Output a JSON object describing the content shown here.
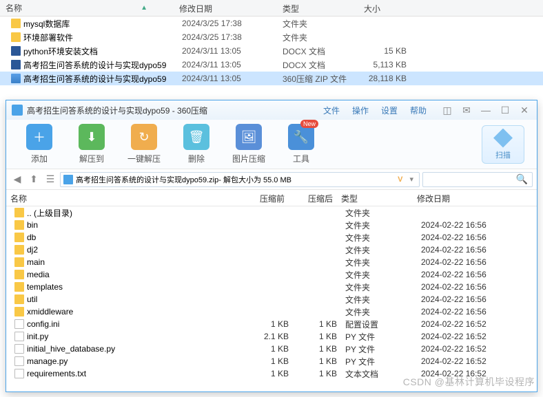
{
  "bg": {
    "headers": {
      "name": "名称",
      "date": "修改日期",
      "type": "类型",
      "size": "大小"
    },
    "rows": [
      {
        "icon": "folder",
        "name": "mysql数据库",
        "date": "2024/3/25 17:38",
        "type": "文件夹",
        "size": ""
      },
      {
        "icon": "folder",
        "name": "环境部署软件",
        "date": "2024/3/25 17:38",
        "type": "文件夹",
        "size": ""
      },
      {
        "icon": "docx",
        "name": "python环境安装文档",
        "date": "2024/3/11 13:05",
        "type": "DOCX 文档",
        "size": "15 KB"
      },
      {
        "icon": "docx",
        "name": "高考招生问答系统的设计与实现dypo59",
        "date": "2024/3/11 13:05",
        "type": "DOCX 文档",
        "size": "5,113 KB"
      },
      {
        "icon": "zip",
        "name": "高考招生问答系统的设计与实现dypo59",
        "date": "2024/3/11 13:05",
        "type": "360压缩 ZIP 文件",
        "size": "28,118 KB",
        "selected": true
      }
    ]
  },
  "zipwin": {
    "title": "高考招生问答系统的设计与实现dypo59 - 360压缩",
    "menu": {
      "file": "文件",
      "op": "操作",
      "set": "设置",
      "help": "帮助"
    },
    "toolbar": {
      "add": "添加",
      "extract": "解压到",
      "onekey": "一键解压",
      "delete": "删除",
      "imgzip": "图片压缩",
      "tools": "工具",
      "new": "New",
      "scan": "扫描"
    },
    "addr": {
      "file": "高考招生问答系统的设计与实现dypo59.zip",
      "info": " - 解包大小为 55.0 MB",
      "v": "V"
    },
    "list_headers": {
      "name": "名称",
      "before": "压缩前",
      "after": "压缩后",
      "type": "类型",
      "date": "修改日期"
    },
    "rows": [
      {
        "icon": "folder",
        "name": ".. (上级目录)",
        "before": "",
        "after": "",
        "type": "文件夹",
        "date": ""
      },
      {
        "icon": "folder",
        "name": "bin",
        "before": "",
        "after": "",
        "type": "文件夹",
        "date": "2024-02-22 16:56"
      },
      {
        "icon": "folder",
        "name": "db",
        "before": "",
        "after": "",
        "type": "文件夹",
        "date": "2024-02-22 16:56"
      },
      {
        "icon": "folder",
        "name": "dj2",
        "before": "",
        "after": "",
        "type": "文件夹",
        "date": "2024-02-22 16:56"
      },
      {
        "icon": "folder",
        "name": "main",
        "before": "",
        "after": "",
        "type": "文件夹",
        "date": "2024-02-22 16:56"
      },
      {
        "icon": "folder",
        "name": "media",
        "before": "",
        "after": "",
        "type": "文件夹",
        "date": "2024-02-22 16:56"
      },
      {
        "icon": "folder",
        "name": "templates",
        "before": "",
        "after": "",
        "type": "文件夹",
        "date": "2024-02-22 16:56"
      },
      {
        "icon": "folder",
        "name": "util",
        "before": "",
        "after": "",
        "type": "文件夹",
        "date": "2024-02-22 16:56"
      },
      {
        "icon": "folder",
        "name": "xmiddleware",
        "before": "",
        "after": "",
        "type": "文件夹",
        "date": "2024-02-22 16:56"
      },
      {
        "icon": "file",
        "name": "config.ini",
        "before": "1 KB",
        "after": "1 KB",
        "type": "配置设置",
        "date": "2024-02-22 16:52"
      },
      {
        "icon": "file",
        "name": "init.py",
        "before": "2.1 KB",
        "after": "1 KB",
        "type": "PY 文件",
        "date": "2024-02-22 16:52"
      },
      {
        "icon": "file",
        "name": "initial_hive_database.py",
        "before": "1 KB",
        "after": "1 KB",
        "type": "PY 文件",
        "date": "2024-02-22 16:52"
      },
      {
        "icon": "file",
        "name": "manage.py",
        "before": "1 KB",
        "after": "1 KB",
        "type": "PY 文件",
        "date": "2024-02-22 16:52"
      },
      {
        "icon": "file",
        "name": "requirements.txt",
        "before": "1 KB",
        "after": "1 KB",
        "type": "文本文档",
        "date": "2024-02-22 16:52"
      }
    ]
  },
  "watermark": "CSDN @基林计算机毕设程序"
}
